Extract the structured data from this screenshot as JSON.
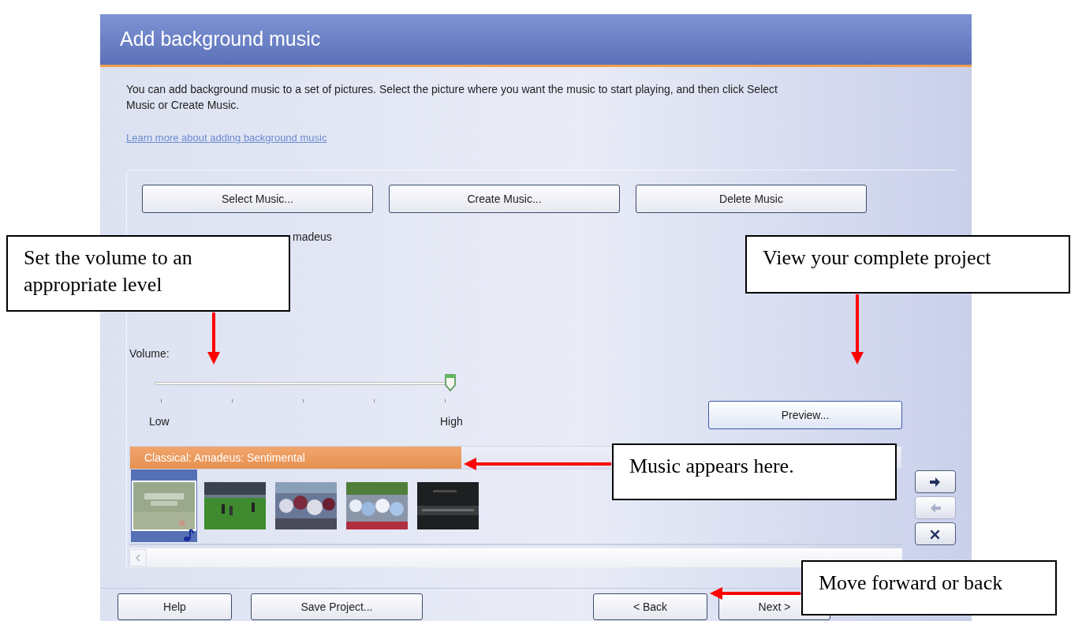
{
  "window": {
    "title": "Add background music"
  },
  "intro": "You can add background music to a set of pictures.  Select the picture where you want the music to start playing, and then click Select Music or Create Music.",
  "help_link": "Learn more about adding background music",
  "music_buttons": [
    "Select Music...",
    "Create Music...",
    "Delete Music"
  ],
  "style_fragment": "madeus",
  "volume": {
    "label": "Volume:",
    "level": 1.0,
    "low": "Low",
    "high": "High"
  },
  "preview_button": "Preview...",
  "timeline": {
    "music_label": "Classical: Amadeus: Sentimental",
    "pictures": [
      {
        "kind": "picture",
        "selected": true,
        "has_music": true
      },
      {
        "kind": "picture",
        "selected": false,
        "has_music": false
      },
      {
        "kind": "picture",
        "selected": false,
        "has_music": false
      },
      {
        "kind": "picture",
        "selected": false,
        "has_music": false
      },
      {
        "kind": "picture",
        "selected": false,
        "has_music": false
      }
    ]
  },
  "side_buttons": [
    {
      "kind": "right",
      "disabled": false
    },
    {
      "kind": "left",
      "disabled": true
    },
    {
      "kind": "remove",
      "disabled": false
    }
  ],
  "footer_buttons": [
    "Help",
    "Save Project...",
    "< Back",
    "Next >"
  ],
  "callouts": [
    {
      "text": "Set the volume to an appropriate level"
    },
    {
      "text": "View your complete project"
    },
    {
      "text": "Music appears here."
    },
    {
      "text": "Move forward or back"
    }
  ]
}
